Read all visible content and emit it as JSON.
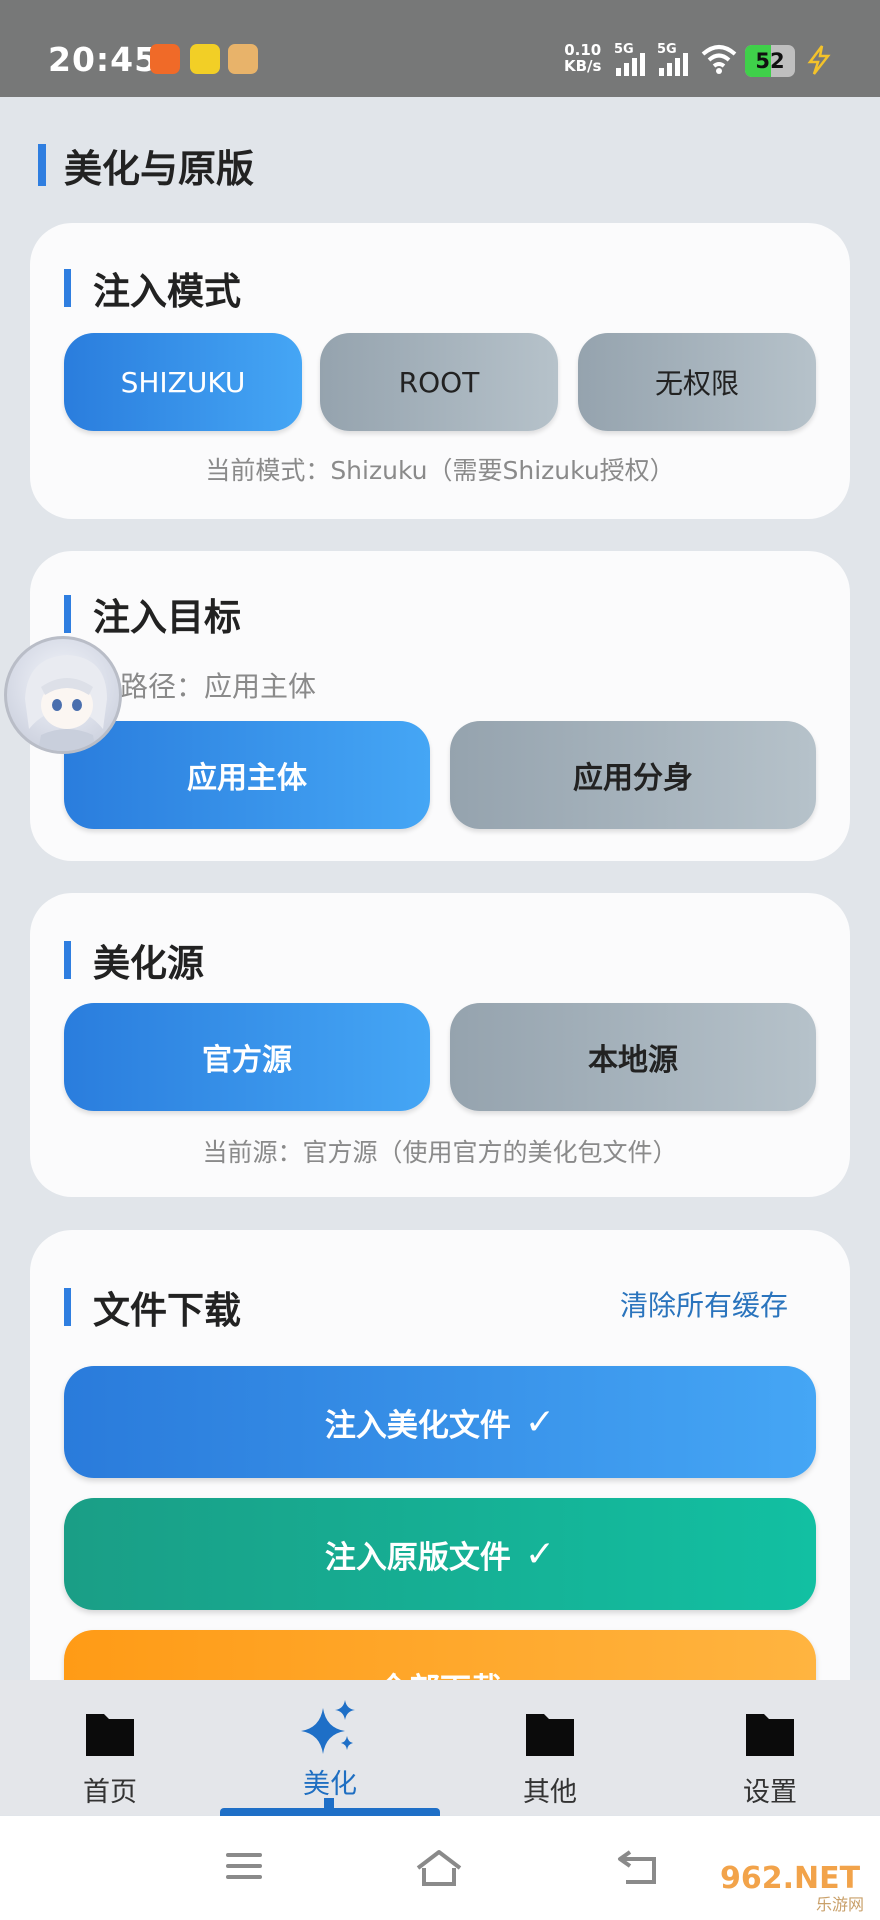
{
  "status_bar": {
    "time": "20:45",
    "net_speed_value": "0.10",
    "net_speed_unit": "KB/s",
    "signal1": "5G",
    "signal2": "5G",
    "battery": "52",
    "battery_level": 0.52
  },
  "page": {
    "section_title": "美化与原版"
  },
  "inject_mode": {
    "title": "注入模式",
    "options": [
      "SHIZUKU",
      "ROOT",
      "无权限"
    ],
    "selected": "SHIZUKU",
    "hint": "当前模式：Shizuku（需要Shizuku授权）"
  },
  "inject_target": {
    "title": "注入目标",
    "path_hint": "当前路径：应用主体",
    "options": [
      "应用主体",
      "应用分身"
    ],
    "selected": "应用主体"
  },
  "beautify_source": {
    "title": "美化源",
    "options": [
      "官方源",
      "本地源"
    ],
    "selected": "官方源",
    "hint": "当前源：官方源（使用官方的美化包文件）"
  },
  "file_download": {
    "title": "文件下载",
    "clear_cache": "清除所有缓存",
    "buttons": [
      "注入美化文件",
      "注入原版文件",
      "全部下载"
    ],
    "check": "✓"
  },
  "bottom_nav": {
    "items": [
      "首页",
      "美化",
      "其他",
      "设置"
    ],
    "active": "美化"
  },
  "watermark": {
    "brand": "962.NET",
    "sub": "乐游网"
  },
  "colors": {
    "accent": "#2f7ee0",
    "active_nav": "#1f6fc2",
    "green": "#12b89a",
    "orange": "#ffa524"
  }
}
